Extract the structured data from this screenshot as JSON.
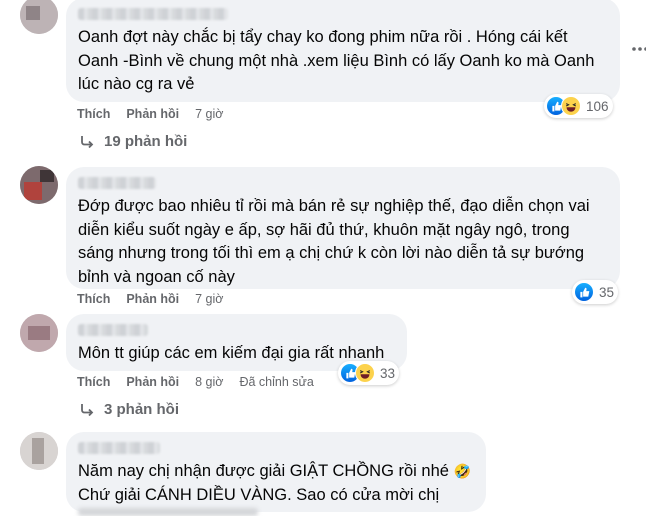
{
  "colors": {
    "bubble": "#f0f2f5",
    "meta_text": "#65676b",
    "like_blue": "#1877f2",
    "haha_yellow": "#fcd24c"
  },
  "comments": [
    {
      "text_lines": [
        "Oanh đợt này chắc bị tẩy chay ko đong phim nữa rồi . Hóng cái kết",
        "Oanh -Bình về chung một nhà .xem liệu Bình có lấy Oanh ko mà Oanh",
        "lúc nào cg ra vẻ"
      ],
      "actions": {
        "like": "Thích",
        "reply": "Phản hồi",
        "time": "7 giờ"
      },
      "reactions": {
        "icons": [
          "like-icon",
          "haha-icon"
        ],
        "count": "106"
      },
      "replies_label": "19 phản hồi"
    },
    {
      "text_lines": [
        "Đớp được bao nhiêu tỉ rồi mà bán rẻ sự nghiệp thế, đạo diễn chọn vai",
        "diễn kiểu suốt ngày e ấp, sợ hãi đủ thứ, khuôn mặt ngây ngô, trong",
        "sáng nhưng trong tối thì em ạ chị chứ k còn lời nào diễn tả sự bướng",
        "bỉnh và ngoan cố này"
      ],
      "actions": {
        "like": "Thích",
        "reply": "Phản hồi",
        "time": "7 giờ"
      },
      "reactions": {
        "icons": [
          "like-icon"
        ],
        "count": "35"
      }
    },
    {
      "text_lines": [
        "Môn tt giúp các em kiếm đại gia rất nhanh"
      ],
      "actions": {
        "like": "Thích",
        "reply": "Phản hồi",
        "time": "8 giờ",
        "edited": "Đã chỉnh sửa"
      },
      "reactions": {
        "icons": [
          "like-icon",
          "haha-icon"
        ],
        "count": "33"
      },
      "replies_label": "3 phản hồi"
    },
    {
      "text_lines": [
        "Năm nay chị nhận được giải GIẬT CHỒNG rồi nhé",
        "Chứ giải CÁNH DIỀU VÀNG. Sao có cửa mời chị"
      ],
      "emoji": "🤣"
    }
  ]
}
